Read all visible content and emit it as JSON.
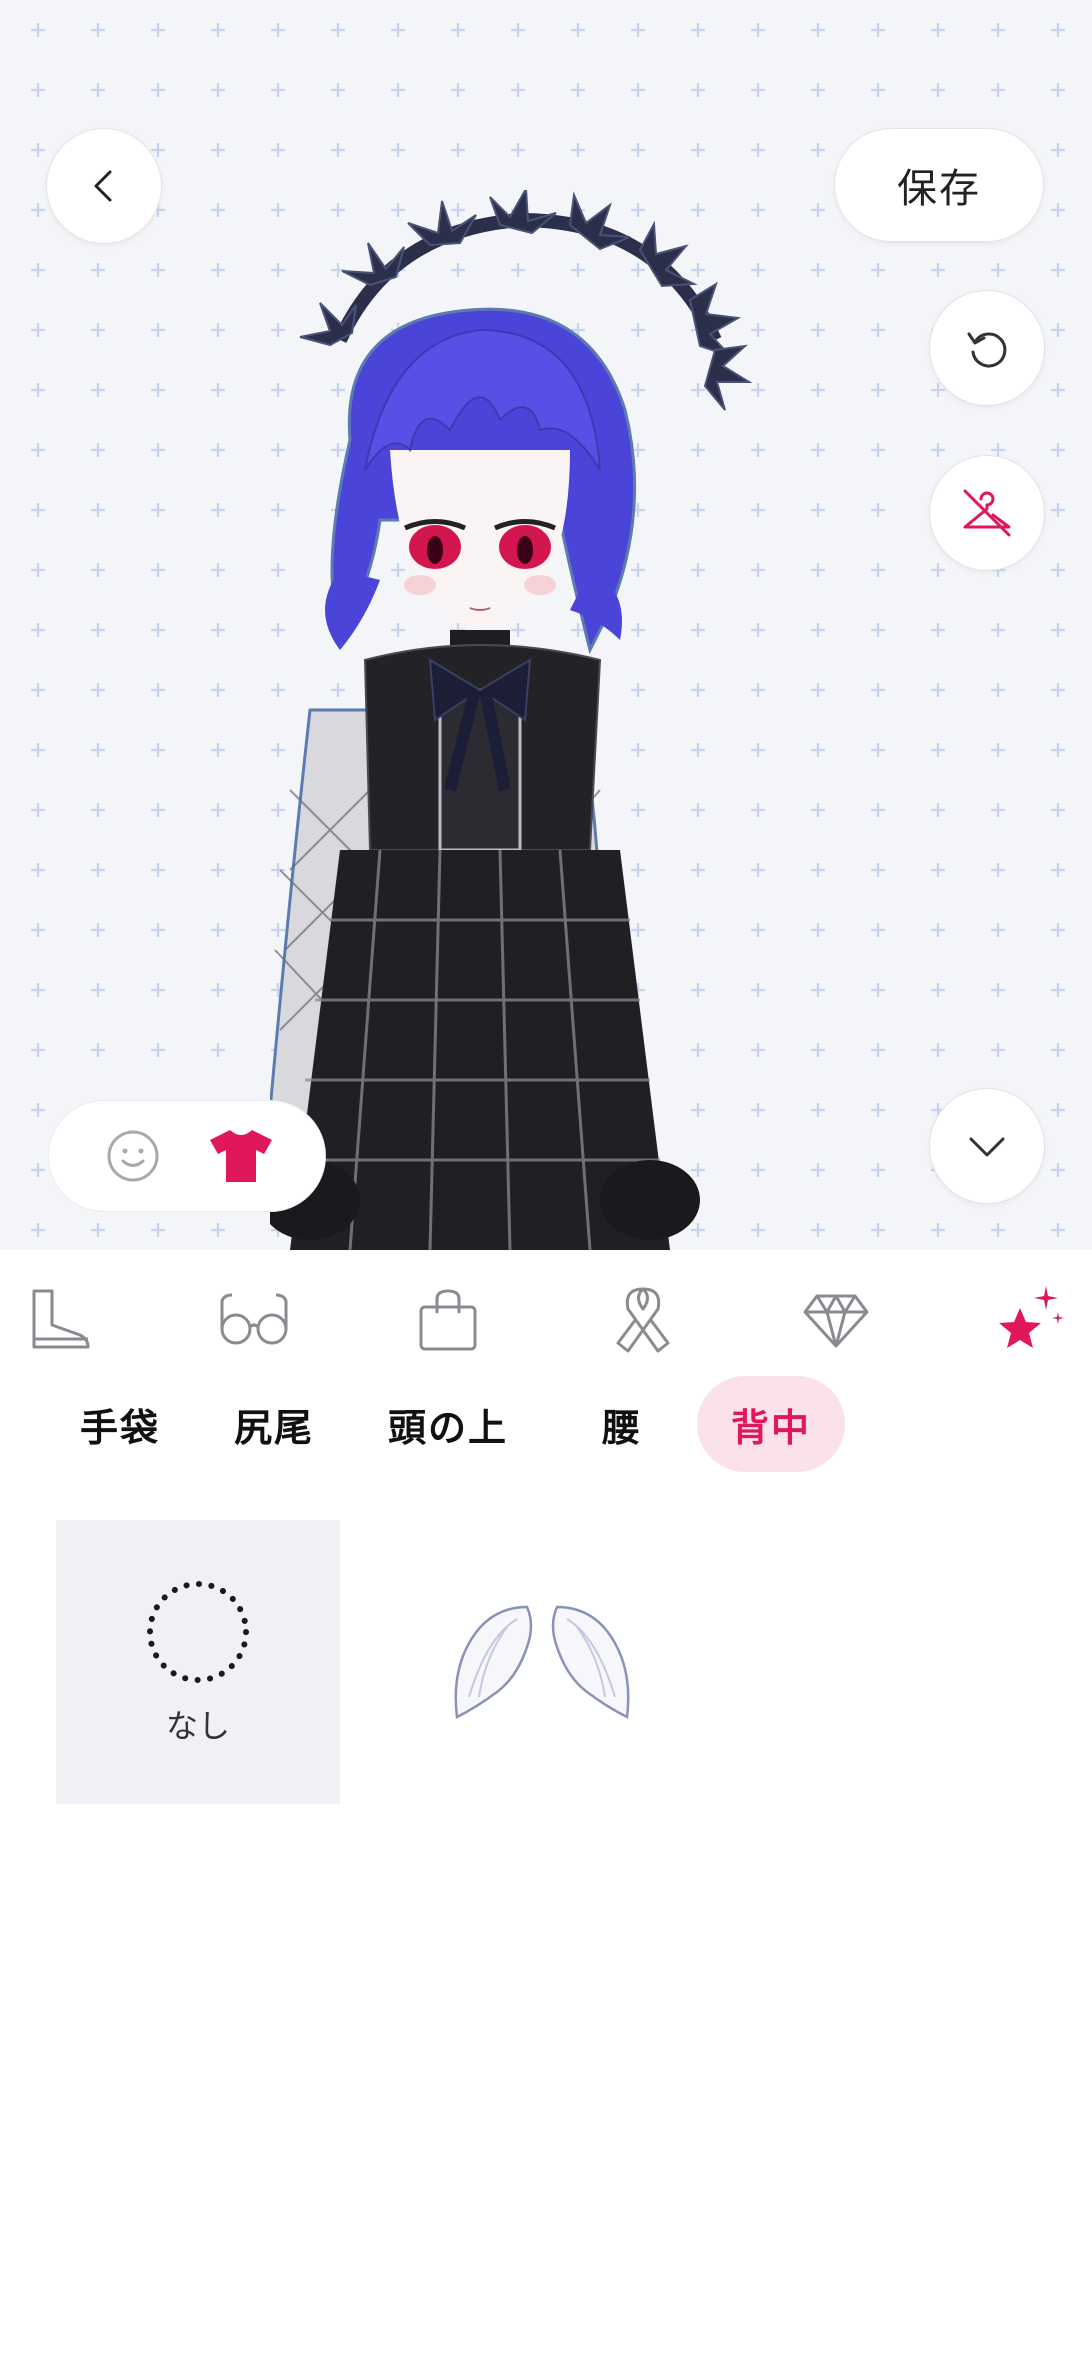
{
  "header": {
    "back_icon": "chevron-left-icon",
    "save_label": "保存"
  },
  "side_controls": {
    "undo_icon": "undo-icon",
    "hide_clothes_icon": "hanger-off-icon",
    "collapse_icon": "chevron-down-icon"
  },
  "mode_toggle": {
    "face_icon": "smiley-face-icon",
    "outfit_icon": "t-shirt-icon",
    "active": "outfit",
    "accent": "#e0185a"
  },
  "categories": [
    {
      "icon": "boot-icon",
      "active": false
    },
    {
      "icon": "glasses-icon",
      "active": false
    },
    {
      "icon": "bag-icon",
      "active": false
    },
    {
      "icon": "ribbon-icon",
      "active": false
    },
    {
      "icon": "diamond-icon",
      "active": false
    },
    {
      "icon": "sparkle-star-icon",
      "active": true
    }
  ],
  "subtabs": [
    {
      "label": "手袋",
      "active": false
    },
    {
      "label": "尻尾",
      "active": false
    },
    {
      "label": "頭の上",
      "active": false
    },
    {
      "label": "腰",
      "active": false
    },
    {
      "label": "背中",
      "active": true
    }
  ],
  "items": [
    {
      "label": "なし",
      "icon": "none-dotted-circle-icon",
      "selected": true
    },
    {
      "label": "",
      "icon": "angel-wings-icon",
      "selected": false
    }
  ],
  "colors": {
    "accent": "#e0185a",
    "accent_bg": "#fbe2ea",
    "grid_plus": "#c7d4ef",
    "preview_bg": "#f4f5f9"
  }
}
